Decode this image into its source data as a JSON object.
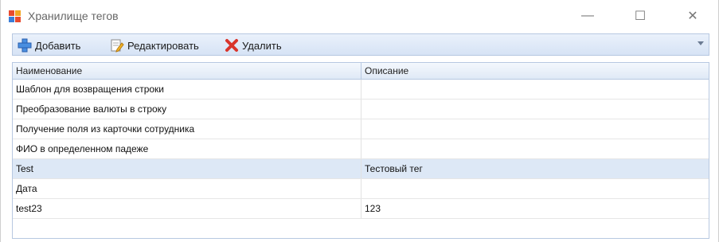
{
  "window": {
    "title": "Хранилище тегов",
    "minimize_glyph": "—",
    "maximize_glyph": "☐",
    "close_glyph": "✕"
  },
  "toolbar": {
    "add_label": "Добавить",
    "edit_label": "Редактировать",
    "delete_label": "Удалить"
  },
  "grid": {
    "columns": [
      "Наименование",
      "Описание"
    ],
    "rows": [
      {
        "name": "Шаблон для возвращения строки",
        "description": ""
      },
      {
        "name": "Преобразование валюты в строку",
        "description": ""
      },
      {
        "name": "Получение поля из карточки сотрудника",
        "description": ""
      },
      {
        "name": "ФИО в определенном падеже",
        "description": ""
      },
      {
        "name": "Test",
        "description": "Тестовый тег"
      },
      {
        "name": "Дата",
        "description": ""
      },
      {
        "name": "test23",
        "description": "123"
      }
    ],
    "selected_row": 4
  },
  "colors": {
    "toolbar_bg": "#d6e3f5",
    "selected_row": "#dde8f6",
    "border": "#b7c8e1"
  }
}
